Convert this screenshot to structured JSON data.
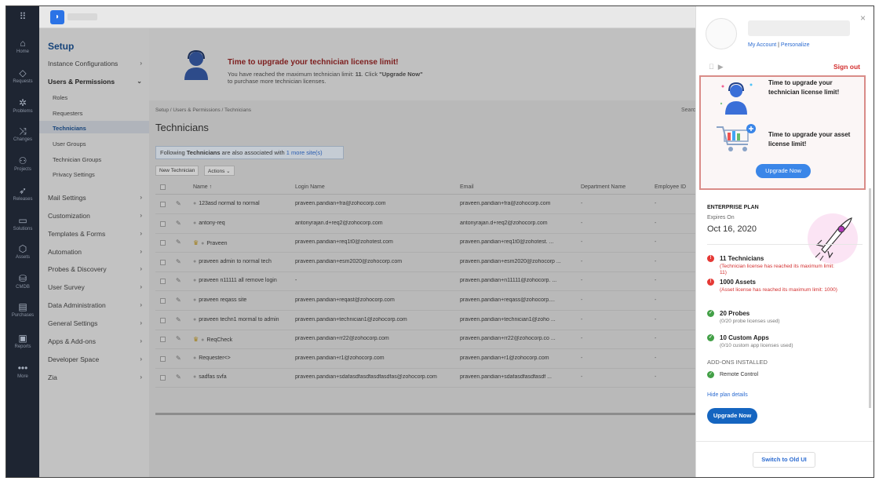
{
  "rail": {
    "items": [
      {
        "icon": "grid-icon",
        "glyph": "⠿",
        "label": ""
      },
      {
        "icon": "home-icon",
        "glyph": "⌂",
        "label": "Home"
      },
      {
        "icon": "requests-icon",
        "glyph": "◇",
        "label": "Requests"
      },
      {
        "icon": "problems-icon",
        "glyph": "✲",
        "label": "Problems"
      },
      {
        "icon": "changes-icon",
        "glyph": "⤨",
        "label": "Changes"
      },
      {
        "icon": "projects-icon",
        "glyph": "⚇",
        "label": "Projects"
      },
      {
        "icon": "releases-icon",
        "glyph": "➶",
        "label": "Releases"
      },
      {
        "icon": "solutions-icon",
        "glyph": "▭",
        "label": "Solutions"
      },
      {
        "icon": "assets-icon",
        "glyph": "⬡",
        "label": "Assets"
      },
      {
        "icon": "cmdb-icon",
        "glyph": "⛁",
        "label": "CMDB"
      },
      {
        "icon": "purchases-icon",
        "glyph": "▤",
        "label": "Purchases"
      },
      {
        "icon": "reports-icon",
        "glyph": "▣",
        "label": "Reports"
      },
      {
        "icon": "more-icon",
        "glyph": "•••",
        "label": "More"
      }
    ]
  },
  "setup": {
    "title": "Setup",
    "items": [
      {
        "label": "Instance Configurations",
        "chev": "›"
      },
      {
        "label": "Users & Permissions",
        "chev": "⌄"
      },
      {
        "label": "Mail Settings",
        "chev": "›"
      },
      {
        "label": "Customization",
        "chev": "›"
      },
      {
        "label": "Templates & Forms",
        "chev": "›"
      },
      {
        "label": "Automation",
        "chev": "›"
      },
      {
        "label": "Probes & Discovery",
        "chev": "›"
      },
      {
        "label": "User Survey",
        "chev": "›"
      },
      {
        "label": "Data Administration",
        "chev": "›"
      },
      {
        "label": "General Settings",
        "chev": "›"
      },
      {
        "label": "Apps & Add-ons",
        "chev": "›"
      },
      {
        "label": "Developer Space",
        "chev": "›"
      },
      {
        "label": "Zia",
        "chev": "›"
      }
    ],
    "sub_items": [
      "Roles",
      "Requesters",
      "Technicians",
      "User Groups",
      "Technician Groups",
      "Privacy Settings"
    ]
  },
  "banner": {
    "title": "Time to upgrade your technician license limit!",
    "line1_pre": "You have reached the maximum technician limit: ",
    "line1_num": "11",
    "line1_mid": ". Click ",
    "line1_cta": "\"Upgrade Now\"",
    "line2": "to purchase more technician licenses."
  },
  "breadcrumb": "Setup / Users & Permissions / Technicians",
  "search_fragment": "Searc",
  "page_title": "Technicians",
  "info": {
    "pre": "Following ",
    "bold": "Technicians",
    "mid": " are also associated with ",
    "link": "1 more site(s)"
  },
  "toolbar": {
    "new_label": "New Technician",
    "actions_label": "Actions ⌄"
  },
  "table": {
    "headers": {
      "name": "Name  ↑",
      "login": "Login Name",
      "email": "Email",
      "dept": "Department Name",
      "emp": "Employee ID"
    },
    "rows": [
      {
        "name": "123asd normal to normal",
        "crown": false,
        "login": "praveen.pandian+fra@zohocorp.com",
        "email": "praveen.pandian+fra@zohocorp.com",
        "dept": "-",
        "emp": "-"
      },
      {
        "name": "antony-req",
        "crown": false,
        "login": "antonyrajan.d+req2@zohocorp.com",
        "email": "antonyrajan.d+req2@zohocorp.com",
        "dept": "-",
        "emp": "-"
      },
      {
        "name": "Praveen",
        "crown": true,
        "login": "praveen.pandian+req1t0@zohotest.com",
        "email": "praveen.pandian+req1t0@zohotest. ...",
        "dept": "-",
        "emp": "-"
      },
      {
        "name": "praveen admin to normal tech",
        "crown": false,
        "login": "praveen.pandian+esm2020@zohocorp.com",
        "email": "praveen.pandian+esm2020@zohocorp ...",
        "dept": "-",
        "emp": "-"
      },
      {
        "name": "praveen n11111 all remove login",
        "crown": false,
        "login": "-",
        "email": "praveen.pandian+n11111@zohocorp. ...",
        "dept": "-",
        "emp": "-"
      },
      {
        "name": "praveen reqass site",
        "crown": false,
        "login": "praveen.pandian+reqast@zohocorp.com",
        "email": "praveen.pandian+reqass@zohocorp....",
        "dept": "-",
        "emp": "-"
      },
      {
        "name": "praveen techn1 mormal to admin",
        "crown": false,
        "login": "praveen.pandian+technician1@zohocorp.com",
        "email": "praveen.pandian+technician1@zoho ...",
        "dept": "-",
        "emp": "-"
      },
      {
        "name": "ReqCheck",
        "crown": true,
        "login": "praveen.pandian+rr22@zohocorp.com",
        "email": "praveen.pandian+rr22@zohocorp.co ...",
        "dept": "-",
        "emp": "-"
      },
      {
        "name": "Requester<>",
        "crown": false,
        "login": "praveen.pandian+r1@zohocorp.com",
        "email": "praveen.pandian+r1@zohocorp.com",
        "dept": "-",
        "emp": "-"
      },
      {
        "name": "sadfas svfa",
        "crown": false,
        "login": "praveen.pandian+sdafasdfasdfasdfasdfas@zohocorp.com",
        "email": "praveen.pandian+sdafasdfasdfasdf ...",
        "dept": "-",
        "emp": "-"
      }
    ]
  },
  "panel": {
    "close": "×",
    "my_account": "My Account",
    "sep": " | ",
    "personalize": "Personalize",
    "sign_out": "Sign out",
    "os_icons": " ",
    "card": {
      "t1": "Time to upgrade your technician license limit!",
      "t2": "Time to upgrade your asset license limit!",
      "button": "Upgrade Now"
    },
    "plan_heading": "ENTERPRISE PLAN",
    "expires_label": "Expires On",
    "expires_date": "Oct 16, 2020",
    "licenses": [
      {
        "status": "red",
        "mark": "!",
        "title": "11 Technicians",
        "sub": "(Technician license has reached its maximum limit: 11)"
      },
      {
        "status": "red",
        "mark": "!",
        "title": "1000 Assets",
        "sub": "(Asset license has reached its maximum limit: 1000)"
      },
      {
        "status": "green",
        "mark": "✓",
        "title": "20 Probes",
        "sub": "(0/20 probe licenses used)"
      },
      {
        "status": "green",
        "mark": "✓",
        "title": "10 Custom Apps",
        "sub": "(0/10 custom app licenses used)"
      }
    ],
    "addons_heading": "ADD-ONS INSTALLED",
    "addon_mark": "✓",
    "addon_name": "Remote Control",
    "hide_plan": "Hide plan details",
    "upgrade_button": "Upgrade Now",
    "switch_old": "Switch to Old UI"
  },
  "colors": {
    "accent": "#3a86e8",
    "danger": "#d32f2f",
    "ok": "#43a047",
    "rail": "#1e2532"
  }
}
